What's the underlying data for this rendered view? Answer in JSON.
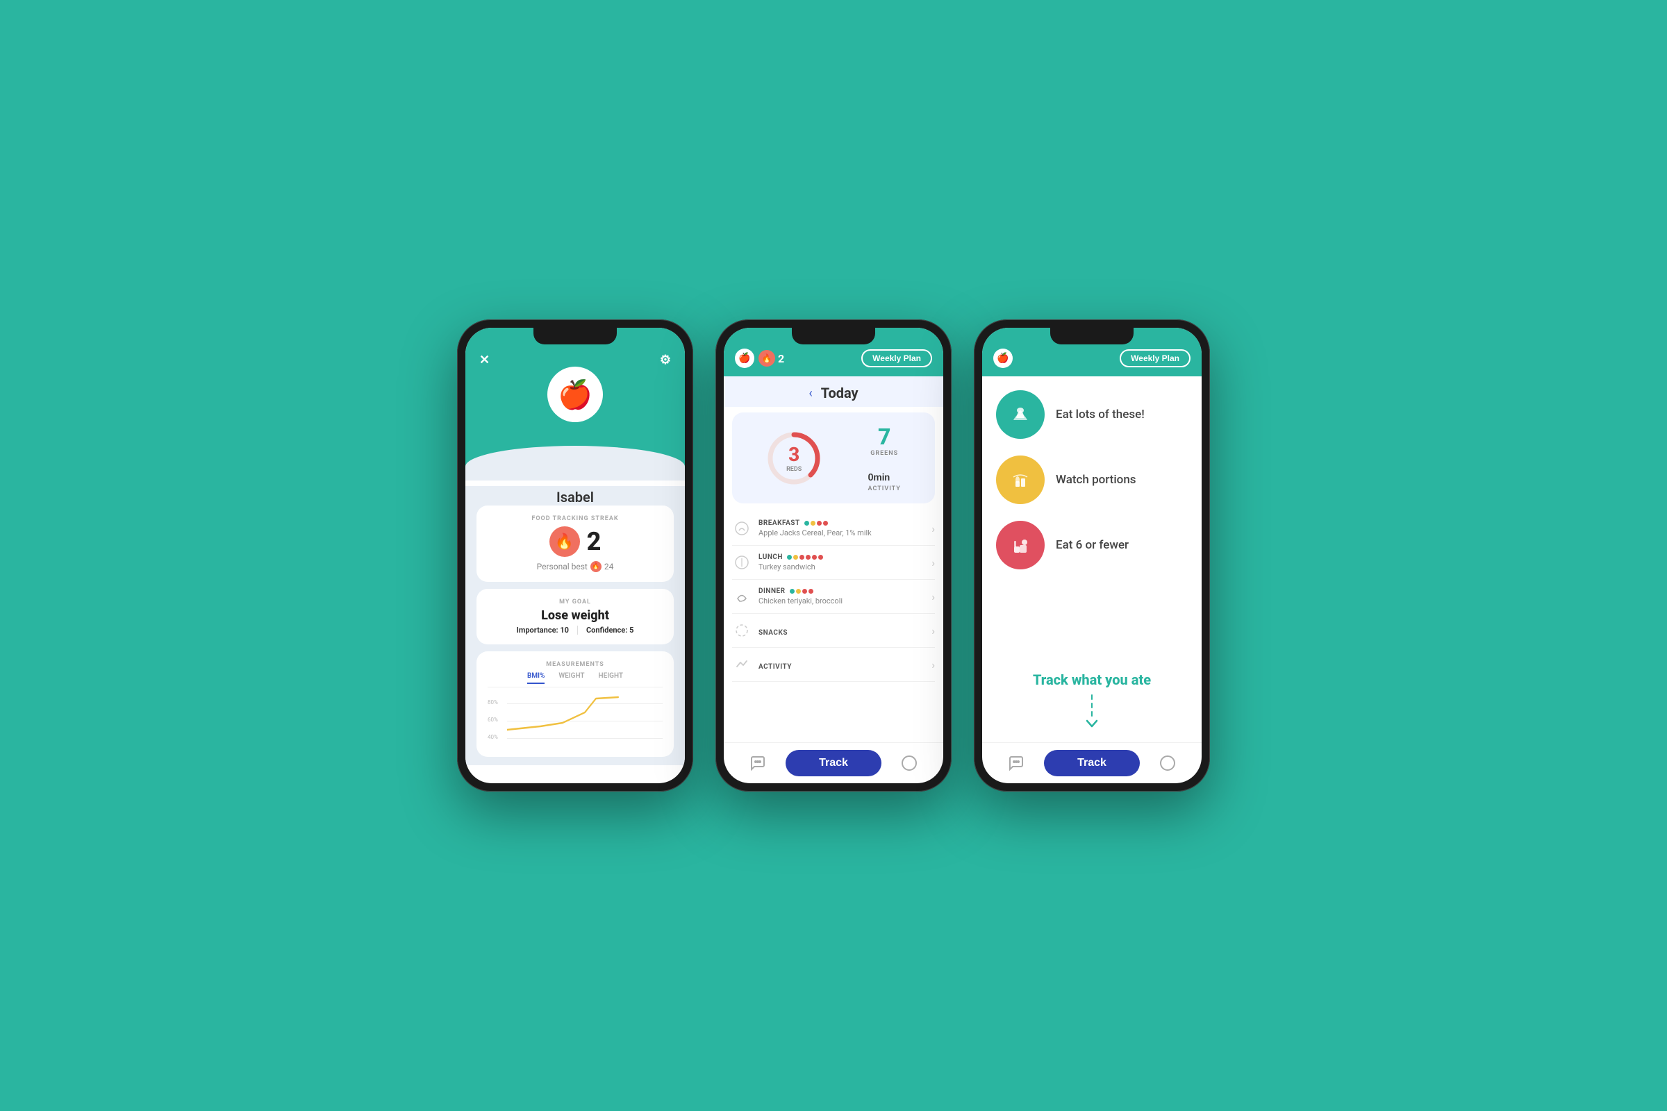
{
  "background": "#2ab5a0",
  "phone1": {
    "username": "Isabel",
    "close_icon": "✕",
    "settings_icon": "⚙",
    "avatar_emoji": "🍎",
    "streak_section": {
      "label": "FOOD TRACKING STREAK",
      "value": "2",
      "personal_best_label": "Personal best",
      "personal_best_value": "24"
    },
    "goal_section": {
      "label": "MY GOAL",
      "goal": "Lose weight",
      "importance_label": "Importance:",
      "importance_value": "10",
      "confidence_label": "Confidence:",
      "confidence_value": "5"
    },
    "measurements_section": {
      "label": "MEASUREMENTS",
      "tabs": [
        "BMI%",
        "WEIGHT",
        "HEIGHT"
      ],
      "active_tab": "BMI%",
      "y_labels": [
        "80%",
        "60%",
        "40%"
      ]
    }
  },
  "phone2": {
    "apple_emoji": "🍎",
    "streak_count": "2",
    "weekly_plan_label": "Weekly Plan",
    "back_arrow": "‹",
    "today_label": "Today",
    "reds_number": "3",
    "reds_label": "REDS",
    "greens_number": "7",
    "greens_label": "GREENS",
    "activity_number": "0",
    "activity_unit": "min",
    "activity_label": "ACTIVITY",
    "meals": [
      {
        "name": "BREAKFAST",
        "desc": "Apple Jacks Cereal, Pear, 1% milk",
        "dots": [
          "#2ab5a0",
          "#f0c040",
          "#e05050",
          "#e05050"
        ],
        "icon_color": "#ccc"
      },
      {
        "name": "LUNCH",
        "desc": "Turkey sandwich",
        "dots": [
          "#2ab5a0",
          "#f0c040",
          "#e05050",
          "#e05050",
          "#e05050",
          "#e05050"
        ],
        "icon_color": "#ccc"
      },
      {
        "name": "DINNER",
        "desc": "Chicken teriyaki, broccoli",
        "dots": [
          "#2ab5a0",
          "#f0c040",
          "#e05050",
          "#e05050"
        ],
        "icon_color": "#aaa"
      },
      {
        "name": "SNACKS",
        "desc": "",
        "dots": [],
        "icon_color": "#ccc"
      },
      {
        "name": "ACTIVITY",
        "desc": "",
        "dots": [],
        "icon_color": "#ccc"
      }
    ],
    "track_label": "Track",
    "chat_icon": "💬",
    "compass_icon": "🧭"
  },
  "phone3": {
    "apple_emoji": "🍎",
    "weekly_plan_label": "Weekly Plan",
    "tips": [
      {
        "icon": "🥦",
        "bg_color": "#2ab5a0",
        "text": "Eat lots of these!"
      },
      {
        "icon": "🌾",
        "bg_color": "#f0c040",
        "text": "Watch portions"
      },
      {
        "icon": "🍔",
        "bg_color": "#e05060",
        "text": "Eat 6 or fewer"
      }
    ],
    "track_section_title": "Track what you ate",
    "track_label": "Track",
    "chat_icon": "💬",
    "compass_icon": "🧭"
  }
}
